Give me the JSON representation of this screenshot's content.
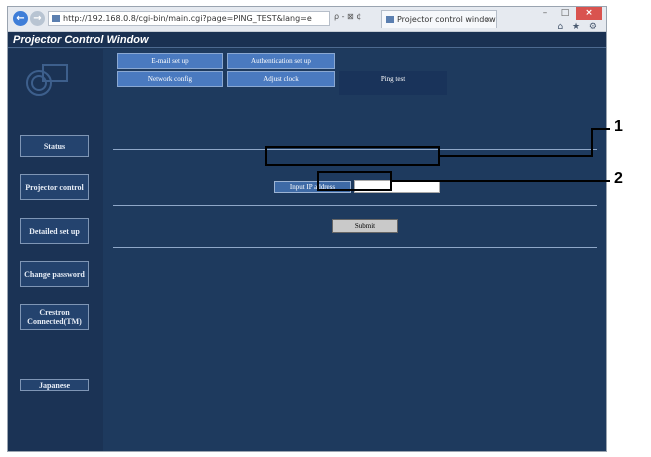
{
  "browser": {
    "back_icon": "back-arrow-icon",
    "forward_icon": "forward-arrow-icon",
    "address": "http://192.168.0.8/cgi-bin/main.cgi?page=PING_TEST&lang=e",
    "address_tools": "ρ - ⊠ ¢",
    "tab_title": "Projector control window",
    "tab_close": "×",
    "win_minimize": "–",
    "win_maximize": "□",
    "win_close": "×",
    "tool_icons": "⌂ ★ ⚙"
  },
  "app": {
    "title": "Projector Control Window"
  },
  "sidebar": {
    "items": [
      {
        "label": "Status"
      },
      {
        "label": "Projector control"
      },
      {
        "label": "Detailed set up"
      },
      {
        "label": "Change password"
      },
      {
        "label": "Crestron Connected(TM)"
      },
      {
        "label": "Japanese"
      }
    ]
  },
  "tabs": {
    "row1": [
      {
        "label": "E-mail set up"
      },
      {
        "label": "Authentication set up"
      }
    ],
    "row2": [
      {
        "label": "Network config"
      },
      {
        "label": "Adjust clock"
      },
      {
        "label": "Ping test"
      }
    ],
    "active": "Ping test"
  },
  "ping_test": {
    "ip_label": "Input IP address",
    "ip_value": "",
    "submit_label": "Submit"
  },
  "callouts": {
    "one": "1",
    "two": "2"
  }
}
